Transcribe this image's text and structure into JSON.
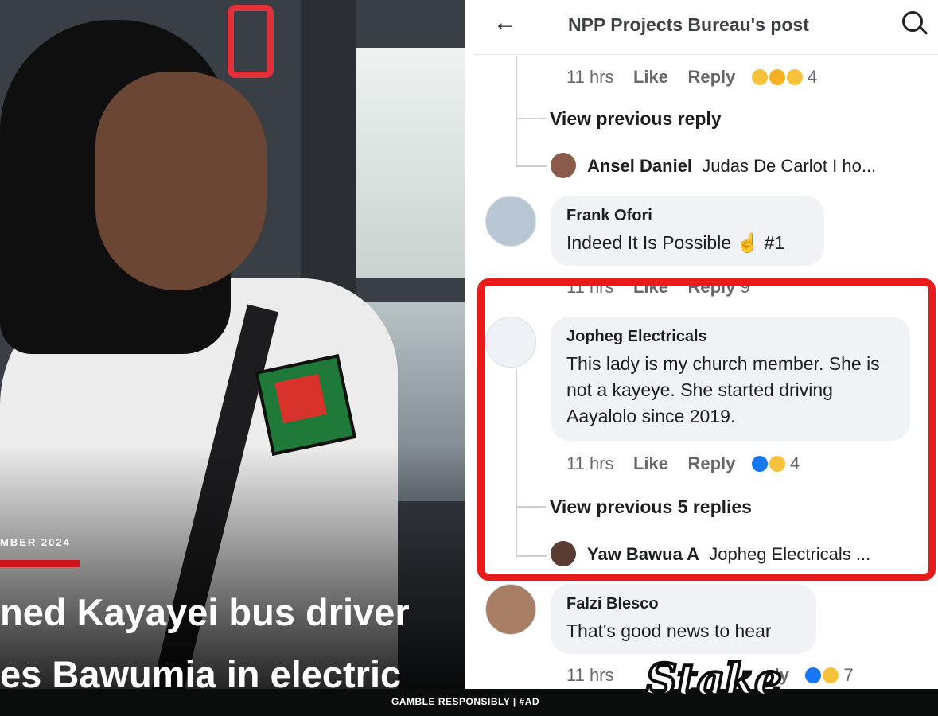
{
  "article": {
    "date_label": "MBER 2024",
    "headline_line1": "ned Kayayei bus driver",
    "headline_line2": "es Bawumia in electric"
  },
  "header": {
    "back_icon": "arrow-left-icon",
    "title": "NPP Projects Bureau's post",
    "search_icon": "search-icon"
  },
  "comments": [
    {
      "meta": {
        "time": "11 hrs",
        "like": "Like",
        "reply": "Reply",
        "count": "4",
        "reactions": [
          "care",
          "haha",
          "care"
        ]
      },
      "view_previous": "View previous reply",
      "reply_preview": {
        "name": "Ansel Daniel",
        "text": "Judas De Carlot I ho..."
      }
    },
    {
      "name": "Frank Ofori",
      "text": "Indeed It Is Possible ☝ #1",
      "meta": {
        "time": "11 hrs",
        "like": "Like",
        "reply": "Reply",
        "count": "9"
      }
    },
    {
      "name": "Jopheg Electricals",
      "text": "This lady is my church member. She is not a kayeye. She started driving Aayalolo since 2019.",
      "meta": {
        "time": "11 hrs",
        "like": "Like",
        "reply": "Reply",
        "count": "4",
        "reactions": [
          "like",
          "sad"
        ]
      },
      "view_previous": "View previous 5 replies",
      "reply_preview": {
        "name": "Yaw Bawua A",
        "text": "Jopheg Electricals ..."
      }
    },
    {
      "name": "Falzi Blesco",
      "text": "That's good news to  hear",
      "meta": {
        "time": "11 hrs",
        "reply": "ly",
        "count": "7",
        "reactions": [
          "like",
          "care"
        ]
      }
    }
  ],
  "ad": {
    "footer_text": "GAMBLE RESPONSIBLY  |  #AD",
    "brand": "Stake"
  },
  "colors": {
    "highlight": "#e81b1b",
    "accent": "#d0141b",
    "facebook_blue": "#1877f2"
  }
}
